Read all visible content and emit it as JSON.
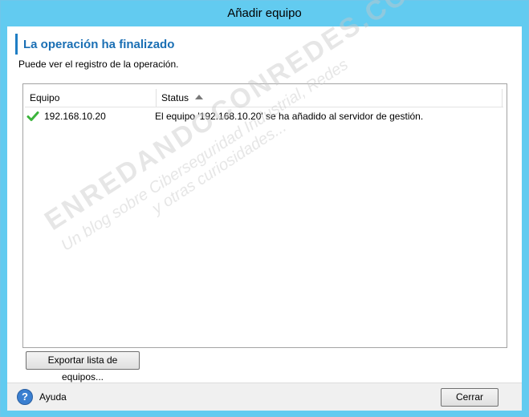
{
  "window": {
    "title": "Añadir equipo"
  },
  "header": {
    "title": "La operación ha finalizado",
    "subtitle": "Puede ver el registro de la operación."
  },
  "table": {
    "columns": [
      "Equipo",
      "Status"
    ],
    "sorted_column": "Status",
    "rows": [
      {
        "icon": "success-check-icon",
        "equipo": "192.168.10.20",
        "status": "El equipo '192.168.10.20' se ha añadido al servidor de gestión."
      }
    ]
  },
  "buttons": {
    "export": "Exportar lista de equipos...",
    "close": "Cerrar"
  },
  "footer": {
    "help_label": "Ayuda",
    "help_icon": "?"
  },
  "watermark": {
    "line1": "ENREDANDOCONREDES.COM",
    "line2": "Un blog sobre Ciberseguridad Industrial, Redes",
    "line3": "y otras curiosidades..."
  },
  "colors": {
    "titlebar": "#62cbf0",
    "header_accent": "#1a6fb4",
    "success": "#3cb43c"
  }
}
